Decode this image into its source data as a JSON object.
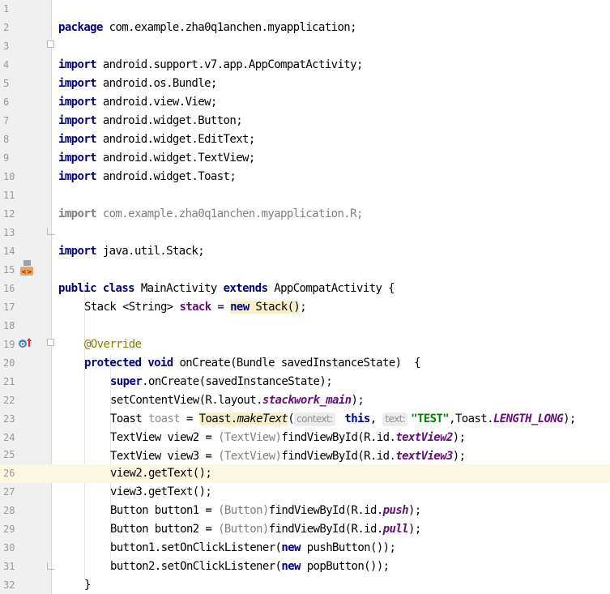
{
  "gutter": {
    "line_numbers": [
      "1",
      "2",
      "3",
      "4",
      "5",
      "6",
      "7",
      "8",
      "9",
      "10",
      "11",
      "12",
      "13",
      "14",
      "15",
      "16",
      "17",
      "18",
      "19",
      "20",
      "21",
      "22",
      "23",
      "24",
      "25",
      "26",
      "27",
      "28",
      "29",
      "30",
      "31",
      "32"
    ]
  },
  "icons": {
    "class_marker": "class-android-icon",
    "override_marker": "override-up-arrow-icon"
  },
  "code": {
    "l1": {
      "kw": "package",
      "rest": " com.example.zha0q1anchen.myapplication;"
    },
    "l3": {
      "kw": "import",
      "rest": " android.support.v7.app.AppCompatActivity;"
    },
    "l4": {
      "kw": "import",
      "rest": " android.os.Bundle;"
    },
    "l5": {
      "kw": "import",
      "rest": " android.view.View;"
    },
    "l6": {
      "kw": "import",
      "rest": " android.widget.Button;"
    },
    "l7": {
      "kw": "import",
      "rest": " android.widget.EditText;"
    },
    "l8": {
      "kw": "import",
      "rest": " android.widget.TextView;"
    },
    "l9": {
      "kw": "import",
      "rest": " android.widget.Toast;"
    },
    "l11": {
      "kw": "import",
      "rest": " com.example.zha0q1anchen.myapplication.R;"
    },
    "l13": {
      "kw": "import",
      "rest": " java.util.Stack;"
    },
    "l15": {
      "kw1": "public",
      "kw2": "class",
      "name": " MainActivity ",
      "kw3": "extends",
      "rest": " AppCompatActivity {"
    },
    "l16": {
      "type": "Stack <String> ",
      "field": "stack",
      "eq": " = ",
      "kw": "new",
      "rest": " Stack()",
      "semi": ";"
    },
    "l18": {
      "anno": "@Override"
    },
    "l19": {
      "kw1": "protected",
      "kw2": "void",
      "rest": " onCreate(Bundle savedInstanceState)  {"
    },
    "l20": {
      "kw": "super",
      "rest": ".onCreate(savedInstanceState);"
    },
    "l21": {
      "pre": "setContentView(R.layout.",
      "field": "stackwork_main",
      "post": ");"
    },
    "l22": {
      "pre": "Toast ",
      "var": "toast",
      "eq": " = ",
      "hl": "Toast.",
      "method": "makeText",
      "paren": "(",
      "hint1": "context:",
      "kw": " this",
      "comma": ", ",
      "hint2": "text:",
      "str": "\"TEST\"",
      "mid": ",Toast.",
      "field": "LENGTH_LONG",
      "post": ");"
    },
    "l23": {
      "pre": "TextView view2 = ",
      "cast": "(TextView)",
      "mid": "findViewById(R.id.",
      "field": "textView2",
      "post": ");"
    },
    "l24": {
      "pre": "TextView view3 = ",
      "cast": "(TextView)",
      "mid": "findViewById(R.id.",
      "field": "textView3",
      "post": ");"
    },
    "l25": {
      "text": "view2.getText();"
    },
    "l26": {
      "text": "view3.getText();"
    },
    "l27": {
      "pre": "Button button1 = ",
      "cast": "(Button)",
      "mid": "findViewById(R.id.",
      "field": "push",
      "post": ");"
    },
    "l28": {
      "pre": "Button button2 = ",
      "cast": "(Button)",
      "mid": "findViewById(R.id.",
      "field": "pull",
      "post": ");"
    },
    "l29": {
      "pre": "button1.setOnClickListener(",
      "kw": "new",
      "post": " pushButton());"
    },
    "l30": {
      "pre": "button2.setOnClickListener(",
      "kw": "new",
      "post": " popButton());"
    },
    "l31": {
      "text": "}"
    }
  }
}
